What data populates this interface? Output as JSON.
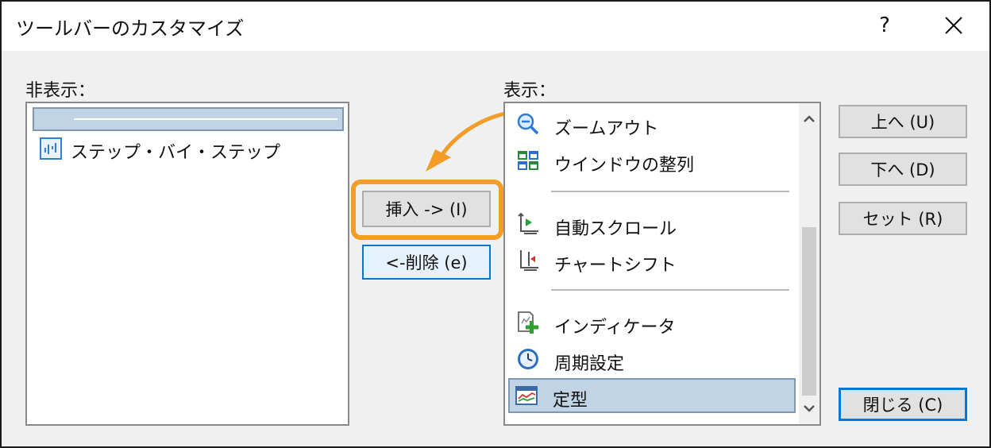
{
  "window": {
    "title": "ツールバーのカスタマイズ",
    "help_label": "?"
  },
  "hidden_panel": {
    "label": "非表示：",
    "items": [
      {
        "type": "separator",
        "selected": true
      },
      {
        "type": "item",
        "icon": "step-by-step-icon",
        "label": "ステップ・バイ・ステップ"
      }
    ]
  },
  "middle": {
    "insert_label": "挿入 -> (I)",
    "remove_label": "<-削除 (e)"
  },
  "shown_panel": {
    "label": "表示：",
    "items": [
      {
        "type": "item",
        "icon": "zoom-out-icon",
        "label": "ズームアウト"
      },
      {
        "type": "item",
        "icon": "tile-windows-icon",
        "label": "ウインドウの整列"
      },
      {
        "type": "separator"
      },
      {
        "type": "item",
        "icon": "auto-scroll-icon",
        "label": "自動スクロール"
      },
      {
        "type": "item",
        "icon": "chart-shift-icon",
        "label": "チャートシフト"
      },
      {
        "type": "separator"
      },
      {
        "type": "item",
        "icon": "indicator-icon",
        "label": "インディケータ"
      },
      {
        "type": "item",
        "icon": "period-clock-icon",
        "label": "周期設定"
      },
      {
        "type": "item",
        "icon": "template-icon",
        "label": "定型",
        "selected": true
      }
    ]
  },
  "right_buttons": {
    "up_label": "上へ (U)",
    "down_label": "下へ (D)",
    "reset_label": "セット (R)",
    "close_label": "閉じる (C)"
  },
  "colors": {
    "highlight": "#f39c26",
    "selection": "#c1d4e6",
    "focus": "#0078d7"
  }
}
